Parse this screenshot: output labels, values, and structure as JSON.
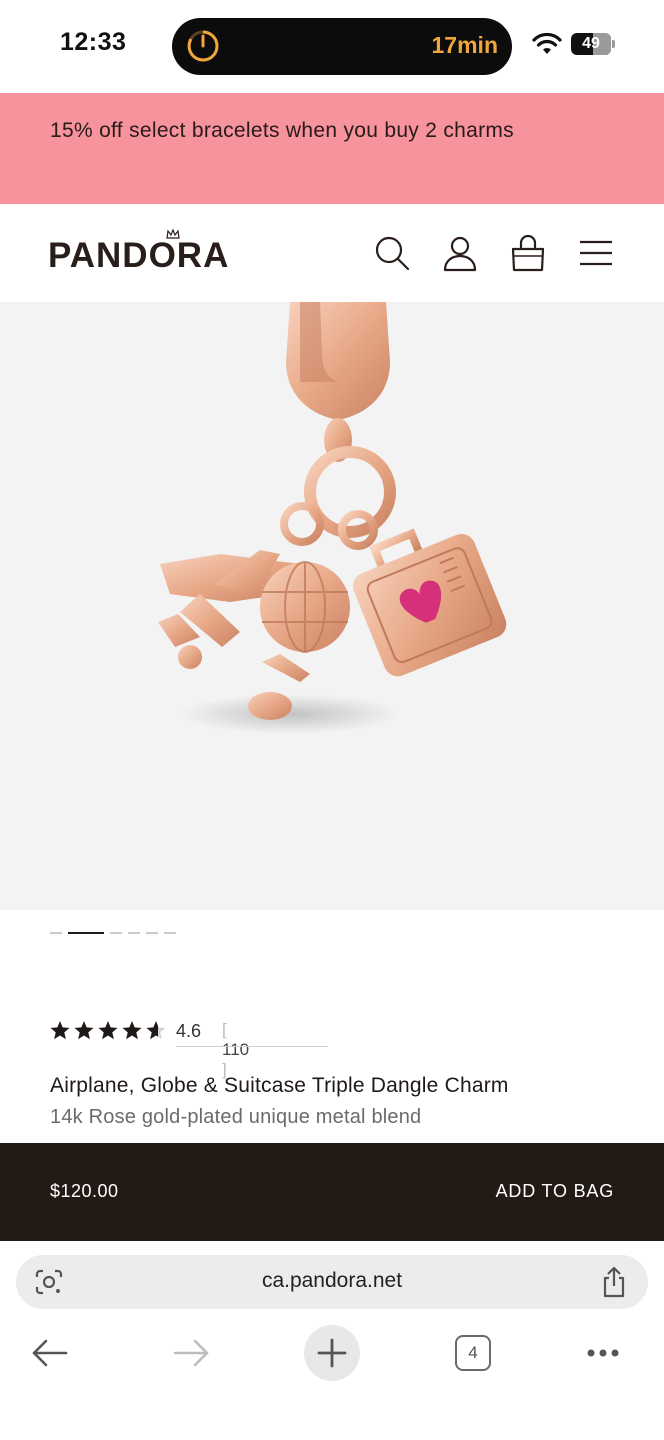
{
  "status_bar": {
    "time": "12:33",
    "island_text": "17min",
    "battery": "49",
    "icons": [
      "timer-icon",
      "wifi-icon",
      "battery-icon"
    ]
  },
  "promo": {
    "text": "15% off select bracelets when you buy 2 charms",
    "background": "#f6939d"
  },
  "header": {
    "logo": "PANDORA",
    "icons": [
      "search-icon",
      "account-icon",
      "bag-icon",
      "menu-icon"
    ]
  },
  "gallery": {
    "page_count": 6,
    "active_page": 2
  },
  "product": {
    "rating": "4.6",
    "rating_stars": 4.6,
    "review_count": "110",
    "title": "Airplane, Globe & Suitcase Triple Dangle Charm",
    "subtitle": "14k Rose gold-plated unique metal blend",
    "price": "$120.00",
    "add_to_bag": "ADD TO BAG"
  },
  "browser": {
    "url": "ca.pandora.net",
    "tab_count": "4",
    "icons": [
      "google-lens-icon",
      "share-icon",
      "back-icon",
      "forward-icon",
      "new-tab-icon",
      "tabs-icon",
      "more-icon"
    ]
  },
  "colors": {
    "buy_bar": "#231a15",
    "accent_orange": "#f0a63a"
  }
}
